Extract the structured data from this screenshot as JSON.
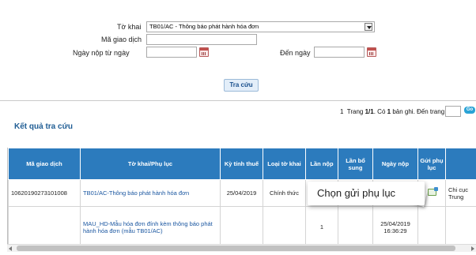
{
  "form": {
    "to_khai_label": "Tờ khai",
    "to_khai_value": "TB01/AC - Thông báo phát hành hóa đơn",
    "ma_giao_dich_label": "Mã giao dịch",
    "ma_giao_dich_value": "",
    "ngay_nop_tu_label": "Ngày nộp từ ngày",
    "ngay_nop_tu_value": "",
    "den_ngay_label": "Đến ngày",
    "den_ngay_value": "",
    "search_button": "Tra cứu"
  },
  "pager": {
    "page_num": "1",
    "trang_label": "Trang",
    "page_of": "1/1",
    "record_prefix": ". Có",
    "record_count": "1",
    "record_suffix": "bản ghi. Đến trang",
    "page_input": "",
    "go_label": "Go"
  },
  "results_title": "Kết quả tra cứu",
  "table": {
    "headers": [
      "Mã giao dịch",
      "Tờ khai/Phụ lục",
      "Kỳ tính thuế",
      "Loại tờ khai",
      "Lần nộp",
      "Lần bổ sung",
      "Ngày nộp",
      "Gửi phụ lục",
      ""
    ],
    "rows": [
      {
        "ma_giao_dich": "10620190273101008",
        "to_khai": "TB01/AC-Thông báo phát hành hóa đơn",
        "ky_tinh_thue": "25/04/2019",
        "loai_to_khai": "Chính thức",
        "lan_nop": "",
        "lan_bo_sung": "",
        "ngay_nop": "",
        "extra": "Chi cục Trung"
      },
      {
        "ma_giao_dich": "",
        "to_khai": "MAU_HD-Mẫu hóa đơn đính kèm thông báo phát hành hóa đơn (mẫu TB01/AC)",
        "ky_tinh_thue": "",
        "loai_to_khai": "",
        "lan_nop": "1",
        "lan_bo_sung": "",
        "ngay_nop": "25/04/2019 16:36:29",
        "extra": ""
      }
    ]
  },
  "callout": {
    "text": "Chọn gửi phụ lục"
  },
  "icons": [
    "calendar-icon",
    "dropdown-arrow-icon",
    "attach-appendix-icon"
  ],
  "colors": {
    "header_blue": "#2c7bbd",
    "title_blue": "#1f5d94",
    "link_blue": "#1a56a0"
  }
}
